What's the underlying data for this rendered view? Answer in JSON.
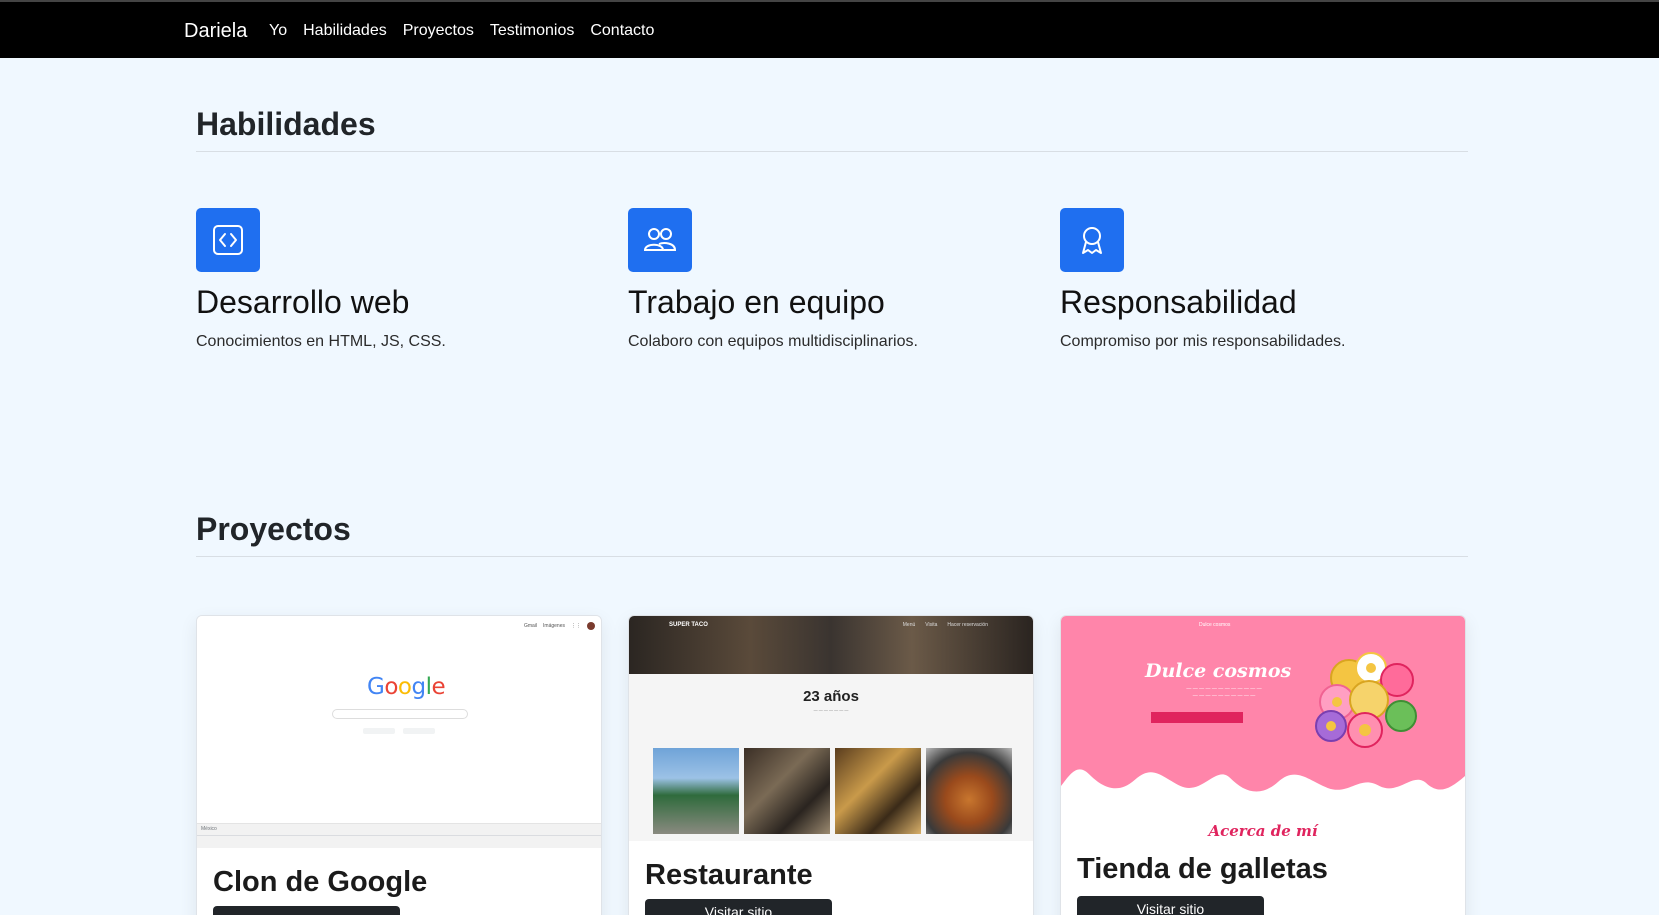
{
  "navbar": {
    "brand": "Dariela",
    "links": [
      "Yo",
      "Habilidades",
      "Proyectos",
      "Testimonios",
      "Contacto"
    ]
  },
  "skills_section": {
    "title": "Habilidades",
    "items": [
      {
        "icon": "code-icon",
        "title": "Desarrollo web",
        "description": "Conocimientos en HTML, JS, CSS."
      },
      {
        "icon": "people-icon",
        "title": "Trabajo en equipo",
        "description": "Colaboro con equipos multidisciplinarios."
      },
      {
        "icon": "award-icon",
        "title": "Responsabilidad",
        "description": "Compromiso por mis responsabilidades."
      }
    ]
  },
  "projects_section": {
    "title": "Proyectos",
    "cards": [
      {
        "title": "Clon de Google",
        "button": "",
        "preview": {
          "top_links": [
            "Gmail",
            "Imágenes"
          ],
          "logo": "Google",
          "footer_country": "México"
        }
      },
      {
        "title": "Restaurante",
        "button": "Visitar sitio",
        "preview": {
          "brand": "SUPER TACO",
          "menu": [
            "Menú",
            "Visita",
            "Hacer reservación"
          ],
          "heading": "23 años"
        }
      },
      {
        "title": "Tienda de galletas",
        "button": "Visitar sitio",
        "preview": {
          "nav": "Dulce cosmos",
          "heading": "Dulce cosmos",
          "subheading": "Acerca de mí"
        }
      }
    ]
  },
  "colors": {
    "accent": "#1f6ff0",
    "navbar_bg": "#000000",
    "page_bg": "#f0f8ff",
    "button_bg": "#212529"
  }
}
